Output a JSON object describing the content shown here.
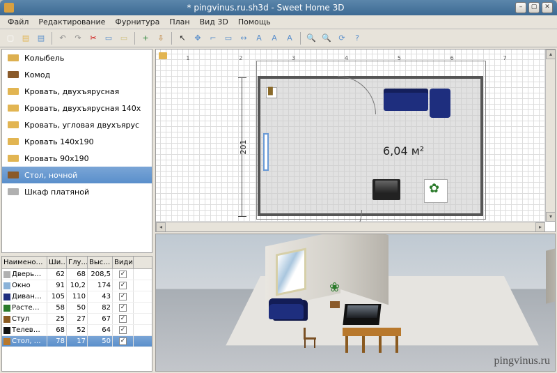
{
  "title": "* pingvinus.ru.sh3d - Sweet Home 3D",
  "menu": {
    "file": "Файл",
    "edit": "Редактирование",
    "furniture": "Фурнитура",
    "plan": "План",
    "view3d": "Вид 3D",
    "help": "Помощь"
  },
  "catalog": {
    "items": [
      {
        "label": "Колыбель"
      },
      {
        "label": "Комод"
      },
      {
        "label": "Кровать, двухъярусная"
      },
      {
        "label": "Кровать, двухъярусная 140x"
      },
      {
        "label": "Кровать, угловая двухъярус"
      },
      {
        "label": "Кровать 140x190"
      },
      {
        "label": "Кровать 90x190"
      },
      {
        "label": "Стол, ночной",
        "selected": true
      },
      {
        "label": "Шкаф платяной"
      }
    ]
  },
  "furniture_table": {
    "headers": {
      "name": "Наимено…",
      "width": "Ши…",
      "depth": "Глу…",
      "height": "Выс…",
      "visible": "Видим…"
    },
    "rows": [
      {
        "name": "Дверь…",
        "w": "62",
        "d": "68",
        "h": "208,5",
        "v": true,
        "icon": "#b0b0b0"
      },
      {
        "name": "Окно",
        "w": "91",
        "d": "10,2",
        "h": "174",
        "v": true,
        "icon": "#8ab2d8"
      },
      {
        "name": "Диван…",
        "w": "105",
        "d": "110",
        "h": "43",
        "v": true,
        "icon": "#1e2e7e"
      },
      {
        "name": "Расте…",
        "w": "58",
        "d": "50",
        "h": "82",
        "v": true,
        "icon": "#2a7a2a"
      },
      {
        "name": "Стул",
        "w": "25",
        "d": "27",
        "h": "67",
        "v": true,
        "icon": "#8a5a20"
      },
      {
        "name": "Телев…",
        "w": "68",
        "d": "52",
        "h": "64",
        "v": true,
        "icon": "#111"
      },
      {
        "name": "Стол, …",
        "w": "78",
        "d": "17",
        "h": "50",
        "v": true,
        "selected": true,
        "icon": "#b8782c"
      }
    ]
  },
  "plan": {
    "ruler": [
      "1",
      "2",
      "3",
      "4",
      "5",
      "6",
      "7"
    ],
    "room_area": "6,04 м²",
    "dim_v": "201"
  },
  "toolbar_names": [
    "new-file",
    "open-file",
    "save-file",
    "undo",
    "redo",
    "cut",
    "copy",
    "paste",
    "insert-furniture",
    "import",
    "pointer",
    "pan",
    "wall-tool",
    "room-tool",
    "dimension-tool",
    "text-tool",
    "text-bold",
    "text-italic",
    "zoom-in",
    "zoom-out",
    "view-rotate",
    "help"
  ],
  "catalog_icon_colors": [
    "#ddb050",
    "#8a5a2a",
    "#e2b552",
    "#e2b552",
    "#e2b552",
    "#e2b552",
    "#e2b552",
    "#8a5a2a",
    "#b0b0b0"
  ],
  "watermark": "pingvinus.ru"
}
